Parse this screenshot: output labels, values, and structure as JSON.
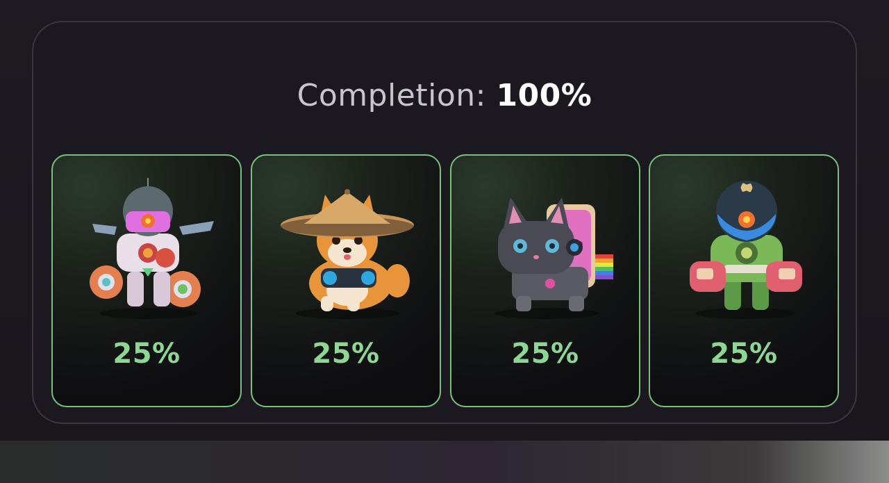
{
  "completion": {
    "label": "Completion:",
    "value": "100%"
  },
  "cards": [
    {
      "name": "robot-astronaut",
      "percent": "25%"
    },
    {
      "name": "shiba-straw-hat",
      "percent": "25%"
    },
    {
      "name": "nyan-robot-cat",
      "percent": "25%"
    },
    {
      "name": "green-mech-bot",
      "percent": "25%"
    }
  ],
  "colors": {
    "accent": "#78c27e",
    "percent_text": "#8ed693",
    "background": "#1b171d"
  }
}
